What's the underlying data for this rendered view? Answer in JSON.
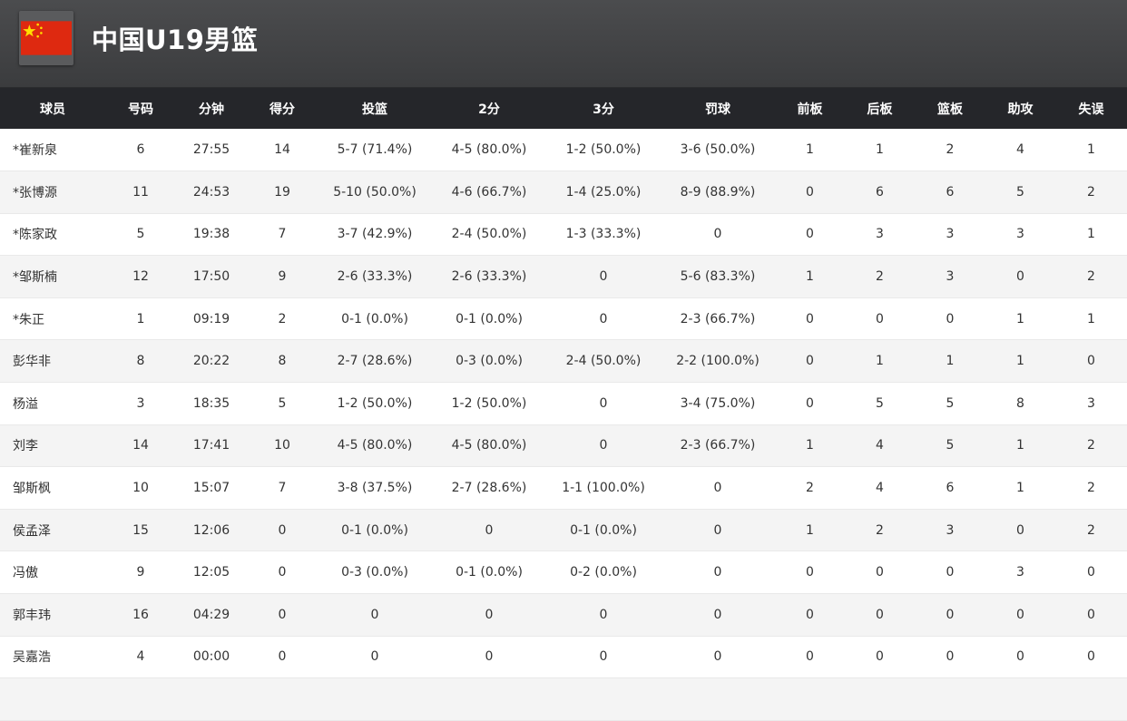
{
  "team": {
    "name": "中国U19男篮",
    "flag_icon": "china-flag-icon",
    "flag_colors": {
      "field": "#de2910",
      "stars": "#ffde00"
    }
  },
  "table": {
    "headers": [
      "球员",
      "号码",
      "分钟",
      "得分",
      "投篮",
      "2分",
      "3分",
      "罚球",
      "前板",
      "后板",
      "篮板",
      "助攻",
      "失误"
    ],
    "rows": [
      [
        "*崔新泉",
        "6",
        "27:55",
        "14",
        "5-7 (71.4%)",
        "4-5 (80.0%)",
        "1-2 (50.0%)",
        "3-6 (50.0%)",
        "1",
        "1",
        "2",
        "4",
        "1"
      ],
      [
        "*张博源",
        "11",
        "24:53",
        "19",
        "5-10 (50.0%)",
        "4-6 (66.7%)",
        "1-4 (25.0%)",
        "8-9 (88.9%)",
        "0",
        "6",
        "6",
        "5",
        "2"
      ],
      [
        "*陈家政",
        "5",
        "19:38",
        "7",
        "3-7 (42.9%)",
        "2-4 (50.0%)",
        "1-3 (33.3%)",
        "0",
        "0",
        "3",
        "3",
        "3",
        "1"
      ],
      [
        "*邹斯楠",
        "12",
        "17:50",
        "9",
        "2-6 (33.3%)",
        "2-6 (33.3%)",
        "0",
        "5-6 (83.3%)",
        "1",
        "2",
        "3",
        "0",
        "2"
      ],
      [
        " *朱正",
        "1",
        "09:19",
        "2",
        "0-1 (0.0%)",
        "0-1 (0.0%)",
        "0",
        "2-3 (66.7%)",
        "0",
        "0",
        "0",
        "1",
        "1"
      ],
      [
        "彭华非",
        "8",
        "20:22",
        "8",
        "2-7 (28.6%)",
        "0-3 (0.0%)",
        "2-4 (50.0%)",
        "2-2 (100.0%)",
        "0",
        "1",
        "1",
        "1",
        "0"
      ],
      [
        " 杨溢",
        "3",
        "18:35",
        "5",
        "1-2 (50.0%)",
        "1-2 (50.0%)",
        "0",
        "3-4 (75.0%)",
        "0",
        "5",
        "5",
        "8",
        "3"
      ],
      [
        " 刘李",
        "14",
        "17:41",
        "10",
        "4-5 (80.0%)",
        "4-5 (80.0%)",
        "0",
        "2-3 (66.7%)",
        "1",
        "4",
        "5",
        "1",
        "2"
      ],
      [
        "邹斯枫",
        "10",
        "15:07",
        "7",
        "3-8 (37.5%)",
        "2-7 (28.6%)",
        "1-1 (100.0%)",
        "0",
        "2",
        "4",
        "6",
        "1",
        "2"
      ],
      [
        "侯孟泽",
        "15",
        "12:06",
        "0",
        "0-1 (0.0%)",
        "0",
        "0-1 (0.0%)",
        "0",
        "1",
        "2",
        "3",
        "0",
        "2"
      ],
      [
        " 冯傲",
        "9",
        "12:05",
        "0",
        "0-3 (0.0%)",
        "0-1 (0.0%)",
        "0-2 (0.0%)",
        "0",
        "0",
        "0",
        "0",
        "3",
        "0"
      ],
      [
        "郭丰玮",
        "16",
        "04:29",
        "0",
        "0",
        "0",
        "0",
        "0",
        "0",
        "0",
        "0",
        "0",
        "0"
      ],
      [
        "吴嘉浩",
        "4",
        "00:00",
        "0",
        "0",
        "0",
        "0",
        "0",
        "0",
        "0",
        "0",
        "0",
        "0"
      ],
      [
        "",
        "",
        "",
        "",
        "",
        "",
        "",
        "",
        "",
        "",
        "",
        "",
        ""
      ]
    ]
  }
}
